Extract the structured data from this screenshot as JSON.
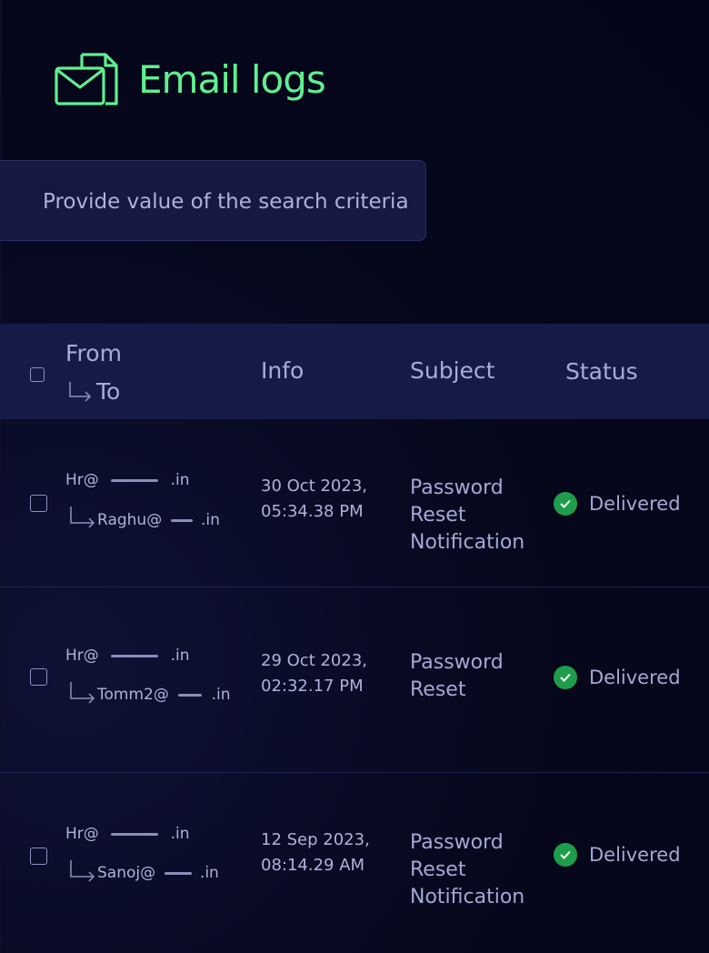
{
  "header": {
    "title": "Email logs",
    "icon": "mail-document-icon",
    "accent_color": "#5ff08f"
  },
  "search": {
    "placeholder": "Provide value of the search criteria"
  },
  "table": {
    "columns": {
      "from": "From",
      "to": "To",
      "info": "Info",
      "subject": "Subject",
      "status": "Status"
    },
    "rows": [
      {
        "from_prefix": "Hr@",
        "from_suffix": ".in",
        "to_prefix": "Raghu@",
        "to_suffix": ".in",
        "date": "30 Oct 2023,",
        "time": "05:34.38 PM",
        "subject_lines": [
          "Password",
          "Reset",
          "Notification"
        ],
        "status": "Delivered"
      },
      {
        "from_prefix": "Hr@",
        "from_suffix": ".in",
        "to_prefix": "Tomm2@",
        "to_suffix": ".in",
        "date": "29 Oct 2023,",
        "time": "02:32.17 PM",
        "subject_lines": [
          "Password",
          "Reset"
        ],
        "status": "Delivered"
      },
      {
        "from_prefix": "Hr@",
        "from_suffix": ".in",
        "to_prefix": "Sanoj@",
        "to_suffix": ".in",
        "date": "12 Sep 2023,",
        "time": "08:14.29 AM",
        "subject_lines": [
          "Password",
          "Reset",
          "Notification"
        ],
        "status": "Delivered"
      }
    ]
  },
  "colors": {
    "delivered": "#1e9e4a",
    "header_bg": "#161a46"
  }
}
